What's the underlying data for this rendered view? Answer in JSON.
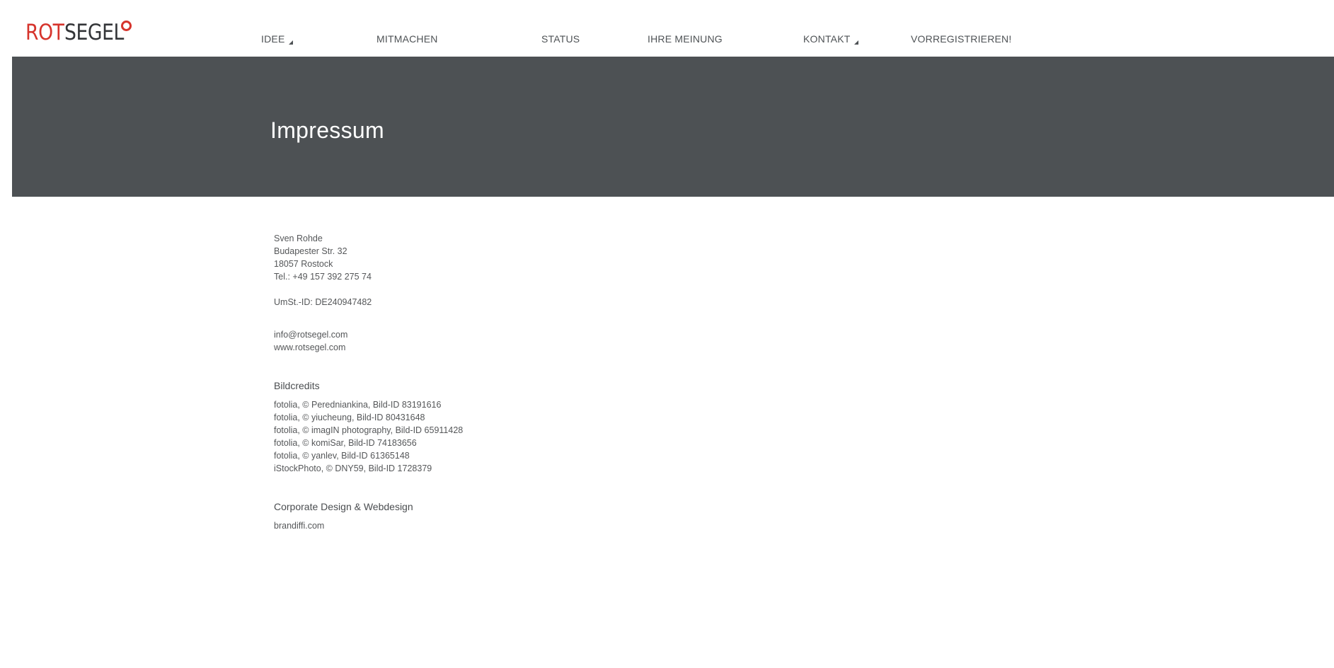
{
  "header": {
    "logo": {
      "part1": "ROT",
      "part2": "SEGEL"
    },
    "nav": [
      {
        "label": "IDEE",
        "has_submenu": true
      },
      {
        "label": "MITMACHEN",
        "has_submenu": false
      },
      {
        "label": "STATUS",
        "has_submenu": false
      },
      {
        "label": "IHRE MEINUNG",
        "has_submenu": false
      },
      {
        "label": "KONTAKT",
        "has_submenu": true
      },
      {
        "label": "VORREGISTRIEREN!",
        "has_submenu": false
      }
    ]
  },
  "banner": {
    "title": "Impressum"
  },
  "address": {
    "name": "Sven Rohde",
    "street": "Budapester Str. 32",
    "city": "18057 Rostock",
    "phone": "Tel.: +49 157 392 275 74",
    "vat": "UmSt.-ID: DE240947482"
  },
  "contact": {
    "email": "info@rotsegel.com",
    "website": "www.rotsegel.com"
  },
  "bildcredits": {
    "heading": "Bildcredits",
    "items": [
      "fotolia, © Peredniankina, Bild-ID 83191616",
      "fotolia, © yiucheung, Bild-ID 80431648",
      "fotolia, © imagIN photography, Bild-ID 65911428",
      "fotolia, © komiSar, Bild-ID 74183656",
      "fotolia, © yanlev, Bild-ID 61365148",
      "iStockPhoto, © DNY59, Bild-ID 1728379"
    ]
  },
  "design": {
    "heading": "Corporate Design & Webdesign",
    "link": "brandiffi.com"
  },
  "colors": {
    "accent": "#d6342c",
    "banner": "#4d5154",
    "text": "#555759"
  }
}
